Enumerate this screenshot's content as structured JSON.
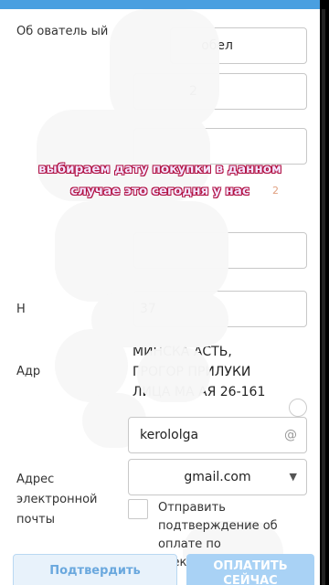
{
  "form": {
    "row1": {
      "label_partial": "Об   ователь ый",
      "value_partial": "обел"
    },
    "row2": {
      "value_partial": "2"
    },
    "row_phone": {
      "label_partial": "Н",
      "value_partial": "37"
    },
    "address": {
      "label_partial": "Адр",
      "line1": "МИНСКА    АСТЬ,",
      "line2": "ГРОГОР        ПРИЛУКИ",
      "line3": "ЛИЦА МА       АЯ 26-161"
    },
    "email": {
      "label": "Адрес электронной почты",
      "username": "kerololga",
      "at_symbol": "@",
      "domain": "gmail.com",
      "chevron_icon": "chevron-down-icon"
    },
    "confirmation": {
      "text": "Отправить подтверждение об оплате по электронной почте."
    }
  },
  "buttons": {
    "confirm_label": "Подтвердить",
    "pay_label": "ОПЛАТИТЬ СЕЙЧАС"
  },
  "overlay": {
    "caption_line1": "выбираем дату покупки в данном",
    "caption_line2": "случае это сегодня у нас",
    "mark": "2"
  },
  "colors": {
    "accent": "#4a9fe0",
    "button_pay_bg": "#a9d2f5",
    "button_confirm_bg": "#e8f2fb",
    "caption_outline": "#b01040"
  }
}
